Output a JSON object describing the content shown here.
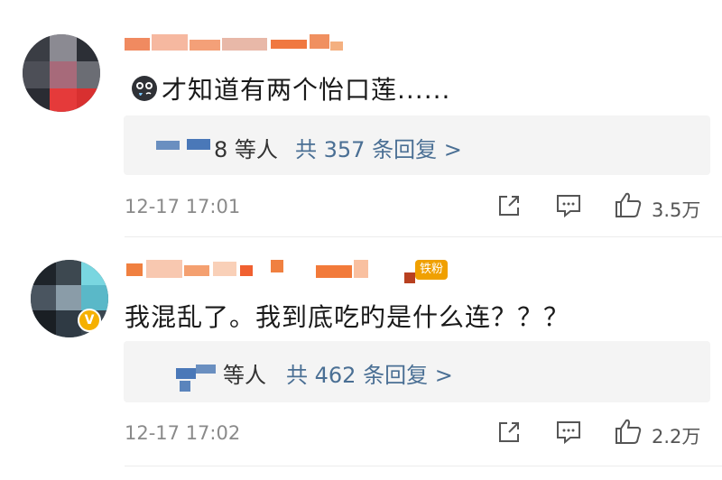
{
  "comments": [
    {
      "text": "才知道有两个怡口莲......",
      "reply_who": "8 等人",
      "reply_total": "共 357 条回复 >",
      "time": "12-17 17:01",
      "likes": "3.5万",
      "emoji": "crying-face-icon"
    },
    {
      "text": "我混乱了。我到底吃旳是什么连？？？",
      "reply_who": "等人",
      "reply_total": "共 462 条回复 >",
      "time": "12-17 17:02",
      "likes": "2.2万",
      "badge": "铁粉"
    }
  ],
  "icons": [
    "share-icon",
    "comment-icon",
    "like-icon"
  ],
  "colors": {
    "link": "#4a6f94",
    "meta": "#8a8a8a",
    "badge": "#f0a000"
  }
}
